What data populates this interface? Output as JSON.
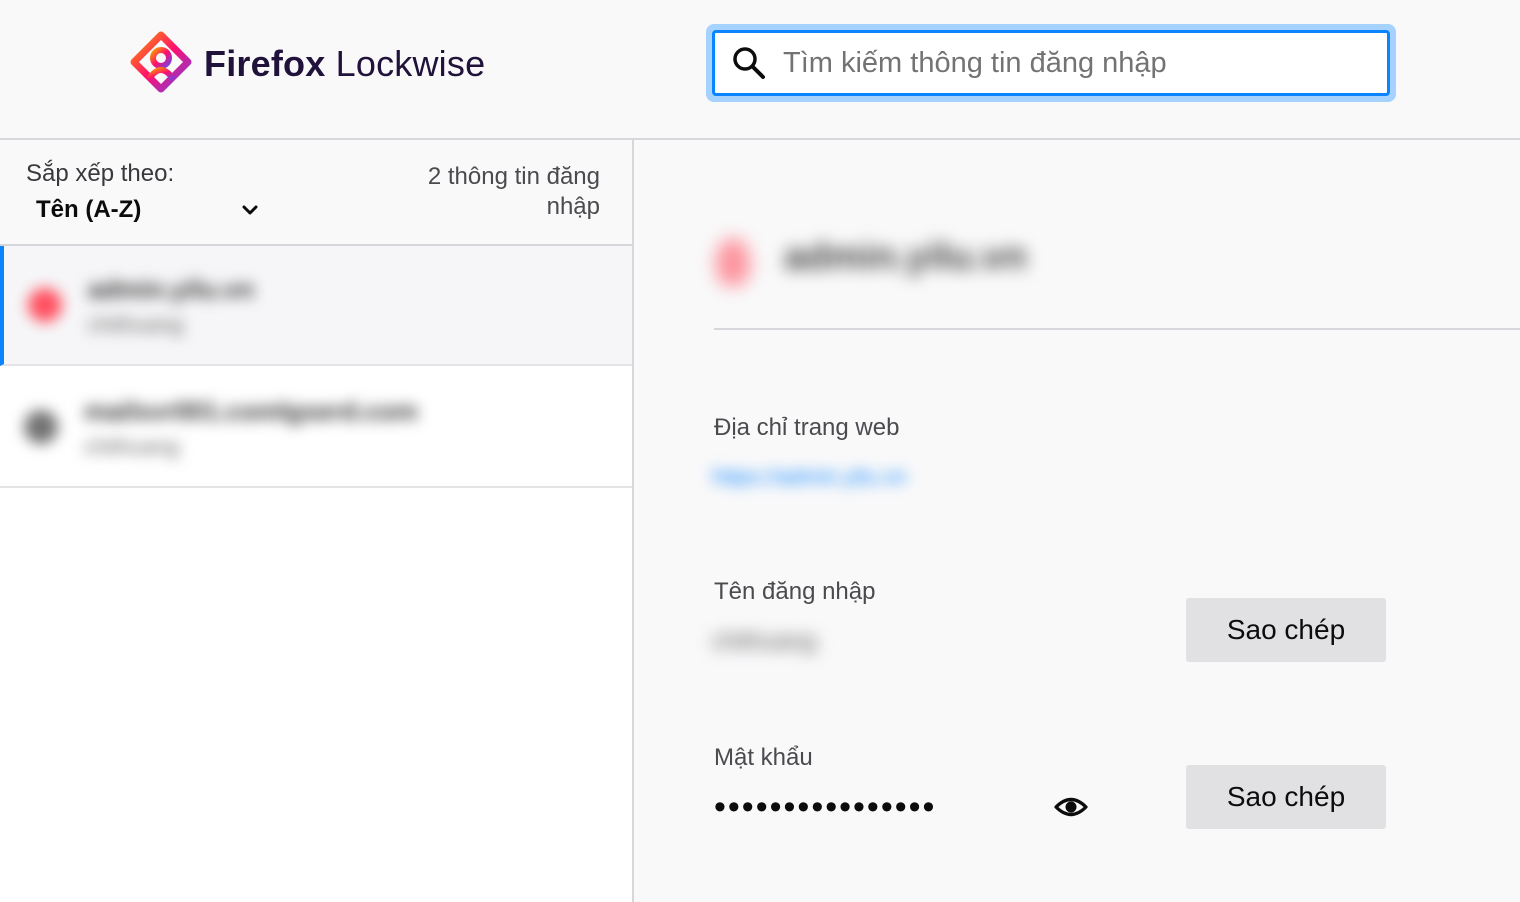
{
  "header": {
    "brand_primary": "Firefox",
    "brand_secondary": "Lockwise",
    "logo_icon": "lockwise-logo-icon",
    "search": {
      "placeholder": "Tìm kiếm thông tin đăng nhập",
      "value": "",
      "icon": "search-icon"
    }
  },
  "sidebar": {
    "sort_label": "Sắp xếp theo:",
    "sort_value": "Tên (A-Z)",
    "sort_icon": "chevron-down-icon",
    "count_text": "2 thông tin đăng nhập",
    "items": [
      {
        "title": "admin.yilu.vn",
        "username": "chithuang",
        "favicon_color": "#ff4f5e",
        "selected": true
      },
      {
        "title": "mailsvr001.comlgserd.com",
        "username": "chithuang",
        "favicon_color": "#737373",
        "selected": false
      }
    ]
  },
  "detail": {
    "title": "admin.yilu.vn",
    "website_label": "Địa chỉ trang web",
    "website_value": "https://admin.yilu.vn",
    "username_label": "Tên đăng nhập",
    "username_value": "chithuang",
    "password_label": "Mật khẩu",
    "password_value": "••••••••••••••••",
    "copy_label": "Sao chép",
    "reveal_icon": "eye-icon"
  },
  "colors": {
    "accent": "#0a84ff",
    "brand_text": "#20123a"
  }
}
